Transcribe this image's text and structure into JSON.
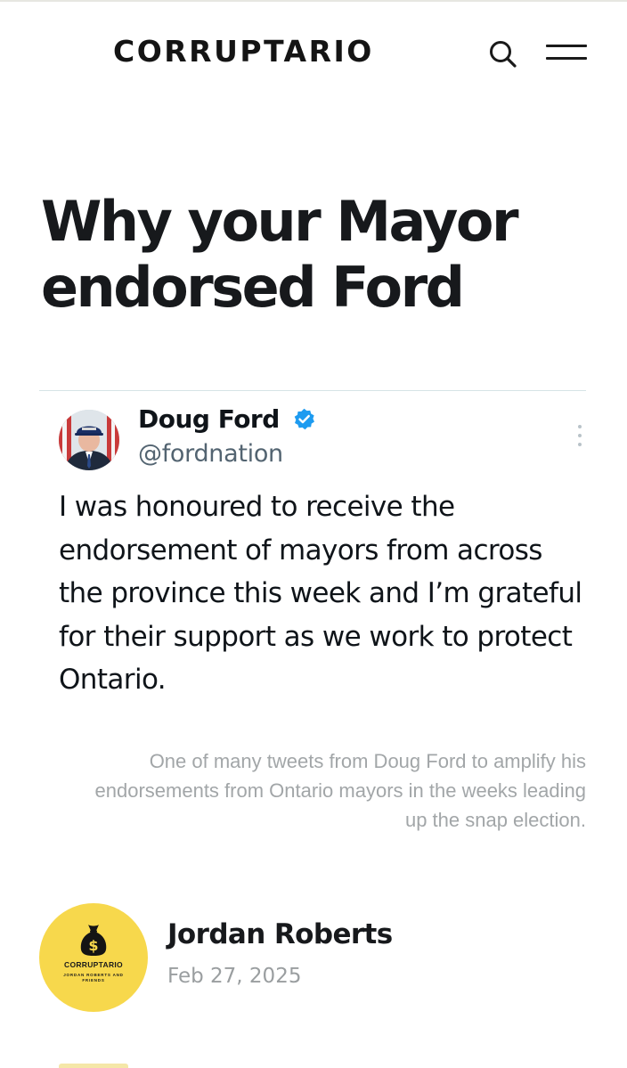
{
  "header": {
    "logo": "CORRUPTARIO",
    "search_icon": "search-icon",
    "menu_icon": "hamburger-menu-icon"
  },
  "article": {
    "title": "Why your Mayor endorsed Ford",
    "embedded_tweet": {
      "author_name": "Doug Ford",
      "verified_icon": "verified-badge-icon",
      "verified_color": "#1d9bf0",
      "handle": "@fordnation",
      "more_icon": "more-options-icon",
      "text": "I was honoured to receive the endorsement of mayors from across the province this week and I’m grateful for their support as we work to protect Ontario."
    },
    "caption": "One of many tweets from Doug Ford to amplify his endorsements from Ontario mayors in the weeks leading up the snap election.",
    "author": {
      "avatar_brand": "CORRUPTARIO",
      "avatar_subtext": "JORDAN ROBERTS AND FRIENDS",
      "avatar_icon": "money-bag-icon",
      "avatar_color": "#f7d84c",
      "name": "Jordan Roberts",
      "date": "Feb 27, 2025"
    }
  }
}
